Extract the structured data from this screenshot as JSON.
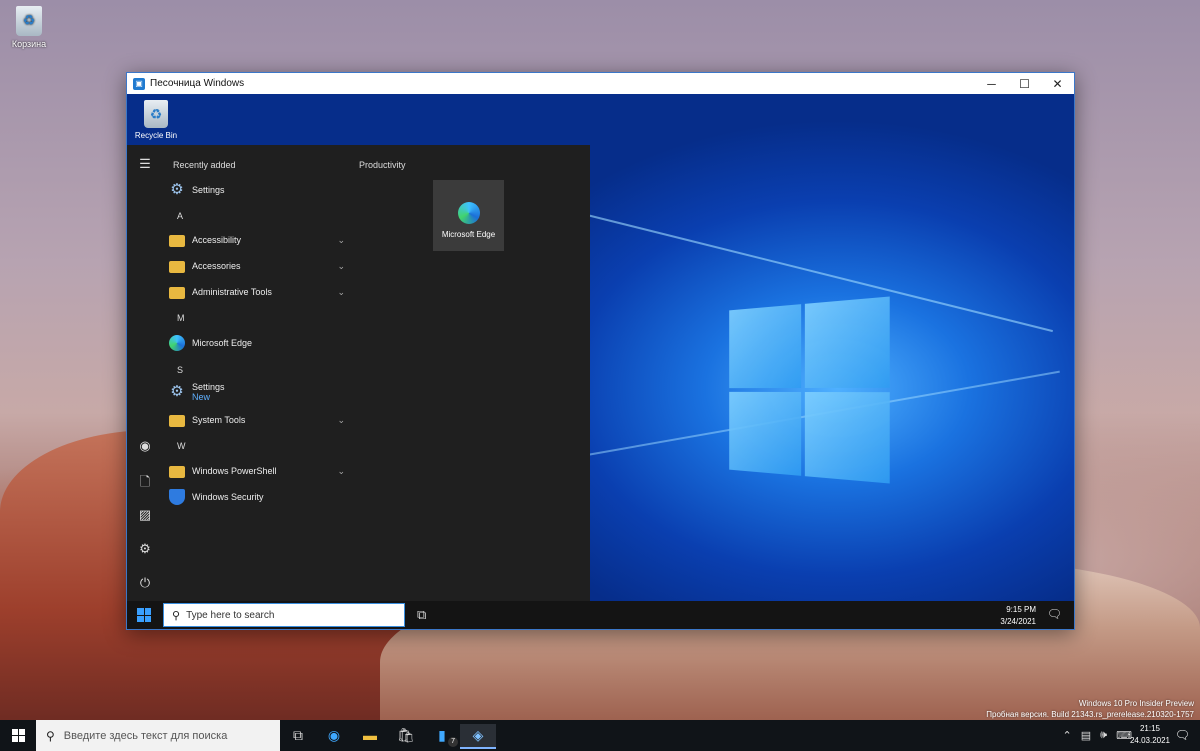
{
  "desktop": {
    "icon_label": "Корзина"
  },
  "sandbox": {
    "title": "Песочница Windows",
    "controls": {
      "minimize": "─",
      "maximize": "☐",
      "close": "✕"
    },
    "recycle_bin_label": "Recycle Bin",
    "start_menu": {
      "recently_added": "Recently added",
      "productivity": "Productivity",
      "tile_label": "Microsoft Edge",
      "items": [
        {
          "type": "app",
          "label": "Settings",
          "icon": "gear-icon"
        },
        {
          "type": "letter",
          "label": "A"
        },
        {
          "type": "folder",
          "label": "Accessibility"
        },
        {
          "type": "folder",
          "label": "Accessories"
        },
        {
          "type": "folder",
          "label": "Administrative Tools"
        },
        {
          "type": "letter",
          "label": "M"
        },
        {
          "type": "app",
          "label": "Microsoft Edge",
          "icon": "edge-icon"
        },
        {
          "type": "letter",
          "label": "S"
        },
        {
          "type": "app",
          "label": "Settings",
          "sub": "New",
          "icon": "gear-icon"
        },
        {
          "type": "folder",
          "label": "System Tools"
        },
        {
          "type": "letter",
          "label": "W"
        },
        {
          "type": "folder",
          "label": "Windows PowerShell"
        },
        {
          "type": "app",
          "label": "Windows Security",
          "icon": "shield-icon"
        }
      ]
    },
    "taskbar": {
      "search_placeholder": "Type here to search",
      "time": "9:15 PM",
      "date": "3/24/2021"
    }
  },
  "host_taskbar": {
    "search_placeholder": "Введите здесь текст для поиска",
    "badge": "7",
    "time": "21:15",
    "date": "24.03.2021"
  },
  "watermark": {
    "line1": "Windows 10 Pro Insider Preview",
    "line2": "Пробная версия. Build 21343.rs_prerelease.210320-1757"
  }
}
